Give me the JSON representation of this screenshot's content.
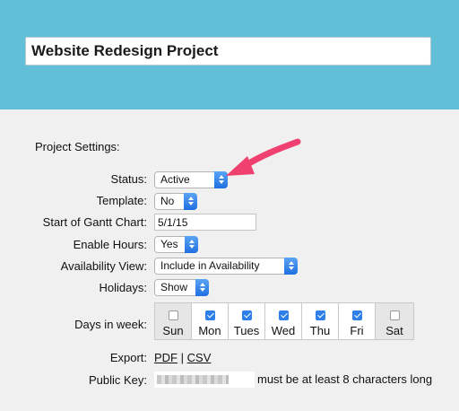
{
  "project": {
    "title": "Website Redesign Project"
  },
  "settings": {
    "heading": "Project Settings:",
    "status": {
      "label": "Status:",
      "value": "Active"
    },
    "template": {
      "label": "Template:",
      "value": "No"
    },
    "gantt_start": {
      "label": "Start of Gantt Chart:",
      "value": "5/1/15"
    },
    "enable_hours": {
      "label": "Enable Hours:",
      "value": "Yes"
    },
    "availability_view": {
      "label": "Availability View:",
      "value": "Include in Availability"
    },
    "holidays": {
      "label": "Holidays:",
      "value": "Show"
    },
    "days_in_week": {
      "label": "Days in week:",
      "days": [
        {
          "name": "Sun",
          "checked": false
        },
        {
          "name": "Mon",
          "checked": true
        },
        {
          "name": "Tues",
          "checked": true
        },
        {
          "name": "Wed",
          "checked": true
        },
        {
          "name": "Thu",
          "checked": true
        },
        {
          "name": "Fri",
          "checked": true
        },
        {
          "name": "Sat",
          "checked": false
        }
      ]
    },
    "export": {
      "label": "Export:",
      "pdf": "PDF",
      "separator": "|",
      "csv": "CSV"
    },
    "public_key": {
      "label": "Public Key:",
      "hint": "must be at least 8 characters long"
    }
  },
  "colors": {
    "header": "#62bfd8",
    "accent": "#2f7fe8",
    "annotation_arrow": "#f0406f"
  },
  "icons": {
    "select_arrow": "chevron-up-down-icon",
    "annotation": "pointer-arrow-icon"
  }
}
